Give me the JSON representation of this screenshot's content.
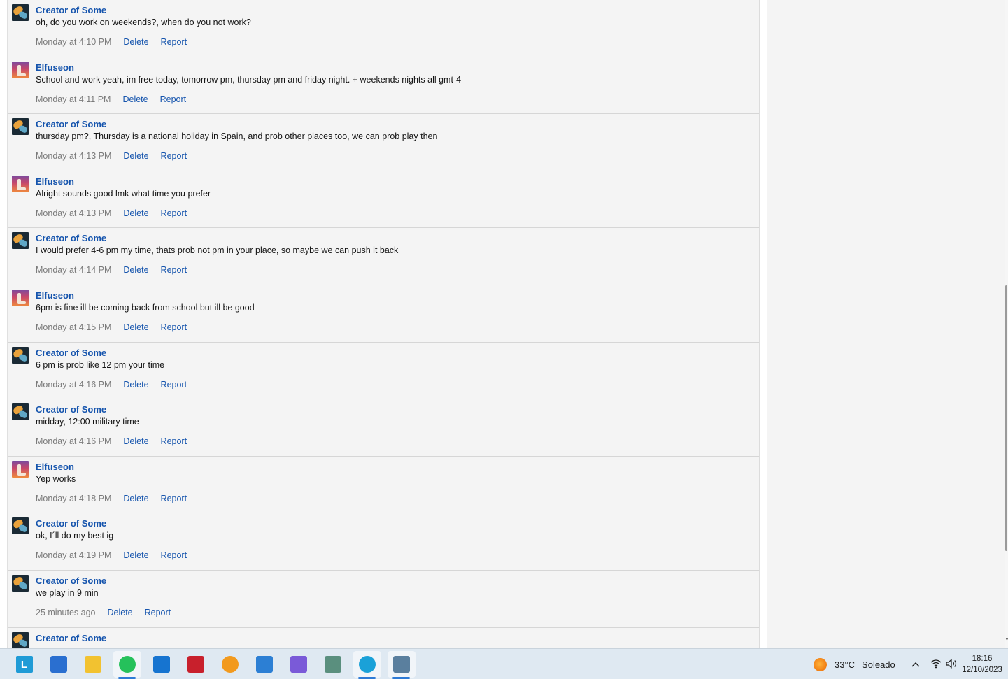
{
  "messages": [
    {
      "author": "Creator of Some",
      "avatar": "creator-avatar",
      "text": "oh, do you work on weekends?, when do you not work?",
      "time": "Monday at 4:10 PM"
    },
    {
      "author": "Elfuseon",
      "avatar": "elfuseon-avatar",
      "text": "School and work yeah, im free today, tomorrow pm, thursday pm and friday night. + weekends nights all gmt-4",
      "time": "Monday at 4:11 PM"
    },
    {
      "author": "Creator of Some",
      "avatar": "creator-avatar",
      "text": "thursday pm?, Thursday is a national holiday in Spain, and prob other places too, we can prob play then",
      "time": "Monday at 4:13 PM"
    },
    {
      "author": "Elfuseon",
      "avatar": "elfuseon-avatar",
      "text": "Alright sounds good lmk what time you prefer",
      "time": "Monday at 4:13 PM"
    },
    {
      "author": "Creator of Some",
      "avatar": "creator-avatar",
      "text": "I would prefer 4-6 pm my time, thats prob not pm in your place, so maybe we can push it back",
      "time": "Monday at 4:14 PM"
    },
    {
      "author": "Elfuseon",
      "avatar": "elfuseon-avatar",
      "text": "6pm is fine ill be coming back from school but ill be good",
      "time": "Monday at 4:15 PM"
    },
    {
      "author": "Creator of Some",
      "avatar": "creator-avatar",
      "text": "6 pm is prob like 12 pm your time",
      "time": "Monday at 4:16 PM"
    },
    {
      "author": "Creator of Some",
      "avatar": "creator-avatar",
      "text": "midday, 12:00 military time",
      "time": "Monday at 4:16 PM"
    },
    {
      "author": "Elfuseon",
      "avatar": "elfuseon-avatar",
      "text": "Yep works",
      "time": "Monday at 4:18 PM"
    },
    {
      "author": "Creator of Some",
      "avatar": "creator-avatar",
      "text": "ok, I´ll do my best ig",
      "time": "Monday at 4:19 PM"
    },
    {
      "author": "Creator of Some",
      "avatar": "creator-avatar",
      "text": "we play in 9 min",
      "time": "25 minutes ago"
    },
    {
      "author": "Creator of Some",
      "avatar": "creator-avatar",
      "text": "",
      "time": ""
    }
  ],
  "actions": {
    "delete": "Delete",
    "report": "Report"
  },
  "taskbar": {
    "apps": [
      {
        "name": "L",
        "icon": "l-app-icon",
        "color": "#1f9bd6"
      },
      {
        "name": "",
        "icon": "store-icon",
        "color": "#2a6fd0"
      },
      {
        "name": "",
        "icon": "file-explorer-icon",
        "color": "#f2c230"
      },
      {
        "name": "",
        "icon": "whatsapp-icon",
        "color": "#25c15b"
      },
      {
        "name": "",
        "icon": "outlook-icon",
        "color": "#1674d0"
      },
      {
        "name": "",
        "icon": "mcafee-icon",
        "color": "#c8202c"
      },
      {
        "name": "",
        "icon": "vpn-icon",
        "color": "#f29a1e"
      },
      {
        "name": "",
        "icon": "mail-icon",
        "color": "#2c7fd4"
      },
      {
        "name": "",
        "icon": "copilot-icon",
        "color": "#7a5ad8"
      },
      {
        "name": "",
        "icon": "chatgpt-icon",
        "color": "#5a8f7e"
      },
      {
        "name": "",
        "icon": "edge-icon",
        "color": "#1aa1d8"
      },
      {
        "name": "",
        "icon": "ssms-icon",
        "color": "#5a7f9e"
      }
    ],
    "weather": {
      "temp": "33°C",
      "condition": "Soleado"
    },
    "time": "18:16",
    "date": "12/10/2023"
  }
}
